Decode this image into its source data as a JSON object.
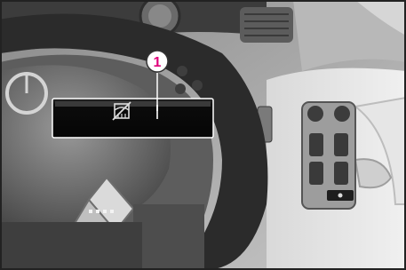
{
  "callout": {
    "number": "1",
    "color": "#e0007a"
  },
  "icons": {
    "panel_icon": "steering-heater-off-icon"
  },
  "colors": {
    "border": "#222222",
    "panel": "#0c0c0c",
    "panel_bar": "#cfcfcf"
  }
}
